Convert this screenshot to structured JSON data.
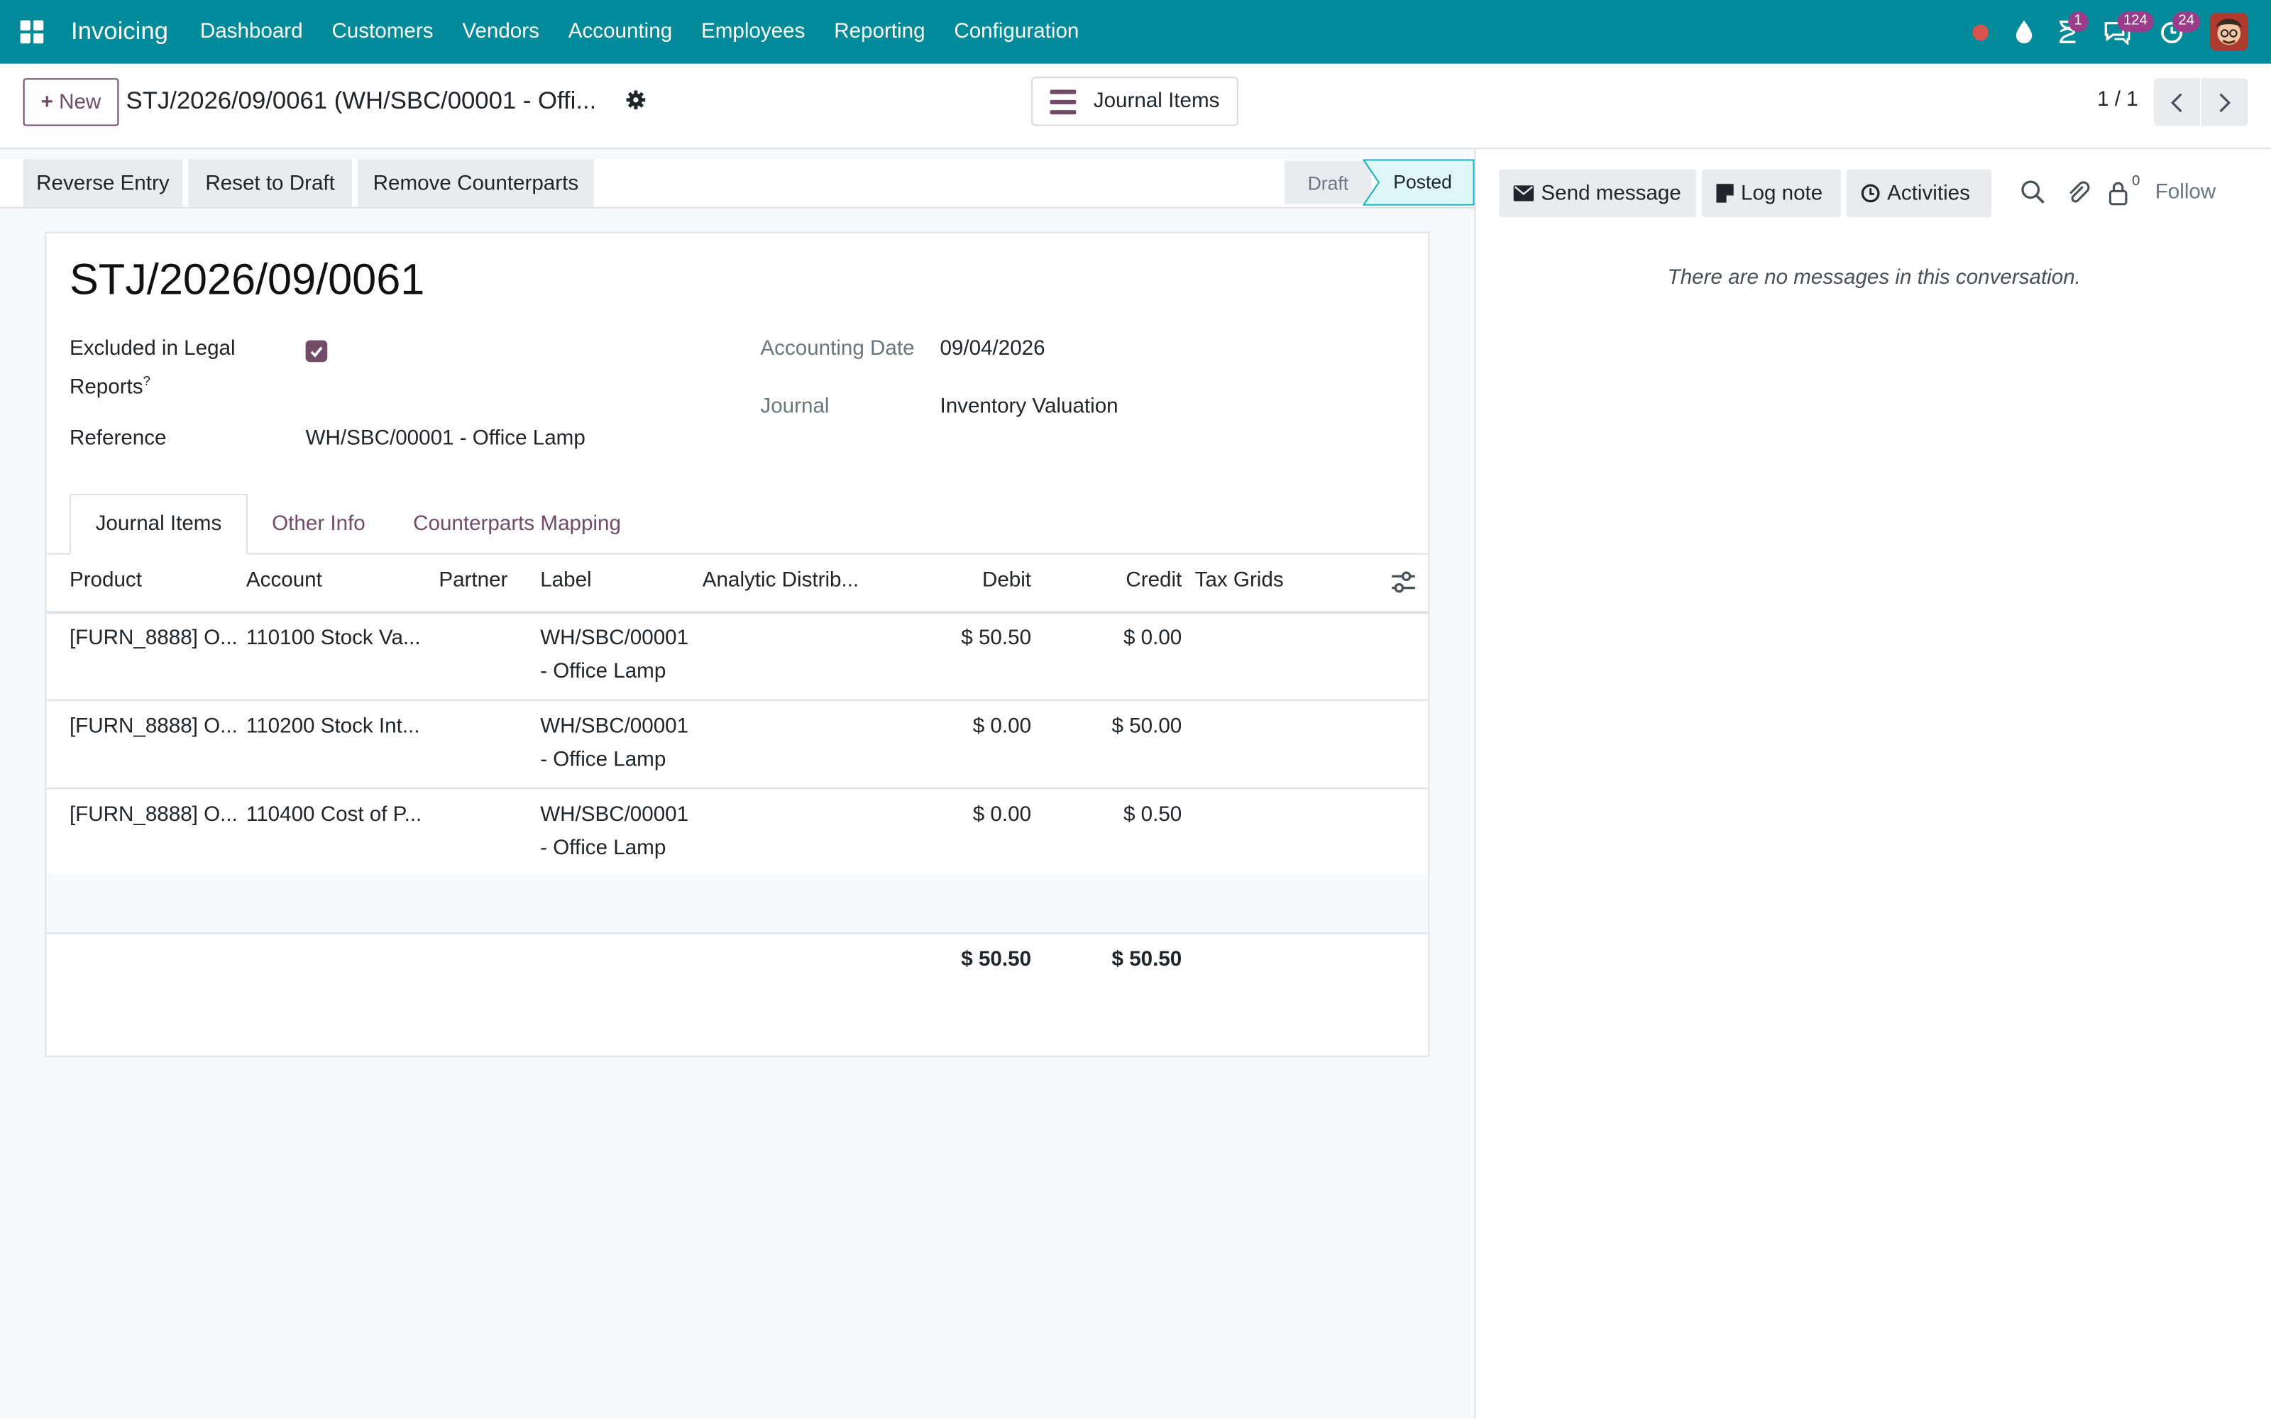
{
  "nav": {
    "app_name": "Invoicing",
    "menus": [
      "Dashboard",
      "Customers",
      "Vendors",
      "Accounting",
      "Employees",
      "Reporting",
      "Configuration"
    ],
    "activity_badge": "1",
    "messages_badge": "124",
    "updates_badge": "24"
  },
  "control": {
    "new_label": "New",
    "breadcrumb": "STJ/2026/09/0061 (WH/SBC/00001 - Offi...",
    "journal_items_label": "Journal Items",
    "pager": "1 / 1"
  },
  "actions": {
    "reverse": "Reverse Entry",
    "reset": "Reset to Draft",
    "remove": "Remove Counterparts"
  },
  "status": {
    "draft": "Draft",
    "posted": "Posted"
  },
  "chatter": {
    "send_message": "Send message",
    "log_note": "Log note",
    "activities": "Activities",
    "followers_count": "0",
    "follow": "Follow",
    "empty": "There are no messages in this conversation."
  },
  "form": {
    "title": "STJ/2026/09/0061",
    "excluded_label_1": "Excluded in Legal",
    "excluded_label_2": "Reports",
    "help_mark": "?",
    "reference_label": "Reference",
    "reference_value": "WH/SBC/00001 - Office Lamp",
    "accounting_date_label": "Accounting Date",
    "accounting_date_value": "09/04/2026",
    "journal_label": "Journal",
    "journal_value": "Inventory Valuation"
  },
  "tabs": [
    "Journal Items",
    "Other Info",
    "Counterparts Mapping"
  ],
  "table": {
    "headers": {
      "product": "Product",
      "account": "Account",
      "partner": "Partner",
      "label": "Label",
      "analytic": "Analytic Distrib...",
      "debit": "Debit",
      "credit": "Credit",
      "tax": "Tax Grids"
    },
    "rows": [
      {
        "product": "[FURN_8888] O...",
        "account": "110100 Stock Va...",
        "label_1": "WH/SBC/00001",
        "label_2": "- Office Lamp",
        "debit": "$ 50.50",
        "credit": "$ 0.00"
      },
      {
        "product": "[FURN_8888] O...",
        "account": "110200 Stock Int...",
        "label_1": "WH/SBC/00001",
        "label_2": "- Office Lamp",
        "debit": "$ 0.00",
        "credit": "$ 50.00"
      },
      {
        "product": "[FURN_8888] O...",
        "account": "110400 Cost of P...",
        "label_1": "WH/SBC/00001",
        "label_2": "- Office Lamp",
        "debit": "$ 0.00",
        "credit": "$ 0.50"
      }
    ],
    "total_debit": "$ 50.50",
    "total_credit": "$ 50.50"
  },
  "colors": {
    "navbar": "#018a99",
    "brand_purple": "#714b67",
    "posted_bg": "#e0f7fa"
  }
}
